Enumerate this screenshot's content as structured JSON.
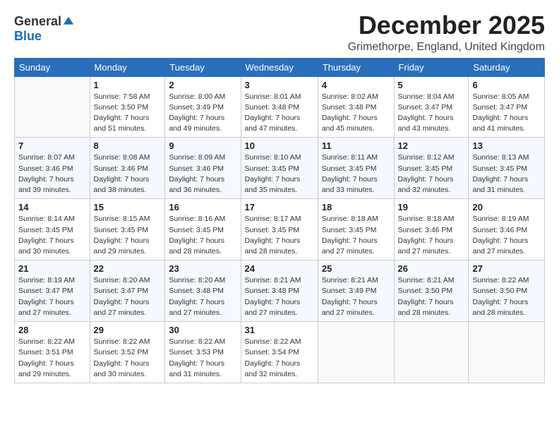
{
  "header": {
    "logo_line1": "General",
    "logo_line2": "Blue",
    "month": "December 2025",
    "location": "Grimethorpe, England, United Kingdom"
  },
  "weekdays": [
    "Sunday",
    "Monday",
    "Tuesday",
    "Wednesday",
    "Thursday",
    "Friday",
    "Saturday"
  ],
  "weeks": [
    [
      {
        "day": "",
        "info": ""
      },
      {
        "day": "1",
        "info": "Sunrise: 7:58 AM\nSunset: 3:50 PM\nDaylight: 7 hours\nand 51 minutes."
      },
      {
        "day": "2",
        "info": "Sunrise: 8:00 AM\nSunset: 3:49 PM\nDaylight: 7 hours\nand 49 minutes."
      },
      {
        "day": "3",
        "info": "Sunrise: 8:01 AM\nSunset: 3:48 PM\nDaylight: 7 hours\nand 47 minutes."
      },
      {
        "day": "4",
        "info": "Sunrise: 8:02 AM\nSunset: 3:48 PM\nDaylight: 7 hours\nand 45 minutes."
      },
      {
        "day": "5",
        "info": "Sunrise: 8:04 AM\nSunset: 3:47 PM\nDaylight: 7 hours\nand 43 minutes."
      },
      {
        "day": "6",
        "info": "Sunrise: 8:05 AM\nSunset: 3:47 PM\nDaylight: 7 hours\nand 41 minutes."
      }
    ],
    [
      {
        "day": "7",
        "info": "Sunrise: 8:07 AM\nSunset: 3:46 PM\nDaylight: 7 hours\nand 39 minutes."
      },
      {
        "day": "8",
        "info": "Sunrise: 8:08 AM\nSunset: 3:46 PM\nDaylight: 7 hours\nand 38 minutes."
      },
      {
        "day": "9",
        "info": "Sunrise: 8:09 AM\nSunset: 3:46 PM\nDaylight: 7 hours\nand 36 minutes."
      },
      {
        "day": "10",
        "info": "Sunrise: 8:10 AM\nSunset: 3:45 PM\nDaylight: 7 hours\nand 35 minutes."
      },
      {
        "day": "11",
        "info": "Sunrise: 8:11 AM\nSunset: 3:45 PM\nDaylight: 7 hours\nand 33 minutes."
      },
      {
        "day": "12",
        "info": "Sunrise: 8:12 AM\nSunset: 3:45 PM\nDaylight: 7 hours\nand 32 minutes."
      },
      {
        "day": "13",
        "info": "Sunrise: 8:13 AM\nSunset: 3:45 PM\nDaylight: 7 hours\nand 31 minutes."
      }
    ],
    [
      {
        "day": "14",
        "info": "Sunrise: 8:14 AM\nSunset: 3:45 PM\nDaylight: 7 hours\nand 30 minutes."
      },
      {
        "day": "15",
        "info": "Sunrise: 8:15 AM\nSunset: 3:45 PM\nDaylight: 7 hours\nand 29 minutes."
      },
      {
        "day": "16",
        "info": "Sunrise: 8:16 AM\nSunset: 3:45 PM\nDaylight: 7 hours\nand 28 minutes."
      },
      {
        "day": "17",
        "info": "Sunrise: 8:17 AM\nSunset: 3:45 PM\nDaylight: 7 hours\nand 28 minutes."
      },
      {
        "day": "18",
        "info": "Sunrise: 8:18 AM\nSunset: 3:45 PM\nDaylight: 7 hours\nand 27 minutes."
      },
      {
        "day": "19",
        "info": "Sunrise: 8:18 AM\nSunset: 3:46 PM\nDaylight: 7 hours\nand 27 minutes."
      },
      {
        "day": "20",
        "info": "Sunrise: 8:19 AM\nSunset: 3:46 PM\nDaylight: 7 hours\nand 27 minutes."
      }
    ],
    [
      {
        "day": "21",
        "info": "Sunrise: 8:19 AM\nSunset: 3:47 PM\nDaylight: 7 hours\nand 27 minutes."
      },
      {
        "day": "22",
        "info": "Sunrise: 8:20 AM\nSunset: 3:47 PM\nDaylight: 7 hours\nand 27 minutes."
      },
      {
        "day": "23",
        "info": "Sunrise: 8:20 AM\nSunset: 3:48 PM\nDaylight: 7 hours\nand 27 minutes."
      },
      {
        "day": "24",
        "info": "Sunrise: 8:21 AM\nSunset: 3:48 PM\nDaylight: 7 hours\nand 27 minutes."
      },
      {
        "day": "25",
        "info": "Sunrise: 8:21 AM\nSunset: 3:49 PM\nDaylight: 7 hours\nand 27 minutes."
      },
      {
        "day": "26",
        "info": "Sunrise: 8:21 AM\nSunset: 3:50 PM\nDaylight: 7 hours\nand 28 minutes."
      },
      {
        "day": "27",
        "info": "Sunrise: 8:22 AM\nSunset: 3:50 PM\nDaylight: 7 hours\nand 28 minutes."
      }
    ],
    [
      {
        "day": "28",
        "info": "Sunrise: 8:22 AM\nSunset: 3:51 PM\nDaylight: 7 hours\nand 29 minutes."
      },
      {
        "day": "29",
        "info": "Sunrise: 8:22 AM\nSunset: 3:52 PM\nDaylight: 7 hours\nand 30 minutes."
      },
      {
        "day": "30",
        "info": "Sunrise: 8:22 AM\nSunset: 3:53 PM\nDaylight: 7 hours\nand 31 minutes."
      },
      {
        "day": "31",
        "info": "Sunrise: 8:22 AM\nSunset: 3:54 PM\nDaylight: 7 hours\nand 32 minutes."
      },
      {
        "day": "",
        "info": ""
      },
      {
        "day": "",
        "info": ""
      },
      {
        "day": "",
        "info": ""
      }
    ]
  ]
}
